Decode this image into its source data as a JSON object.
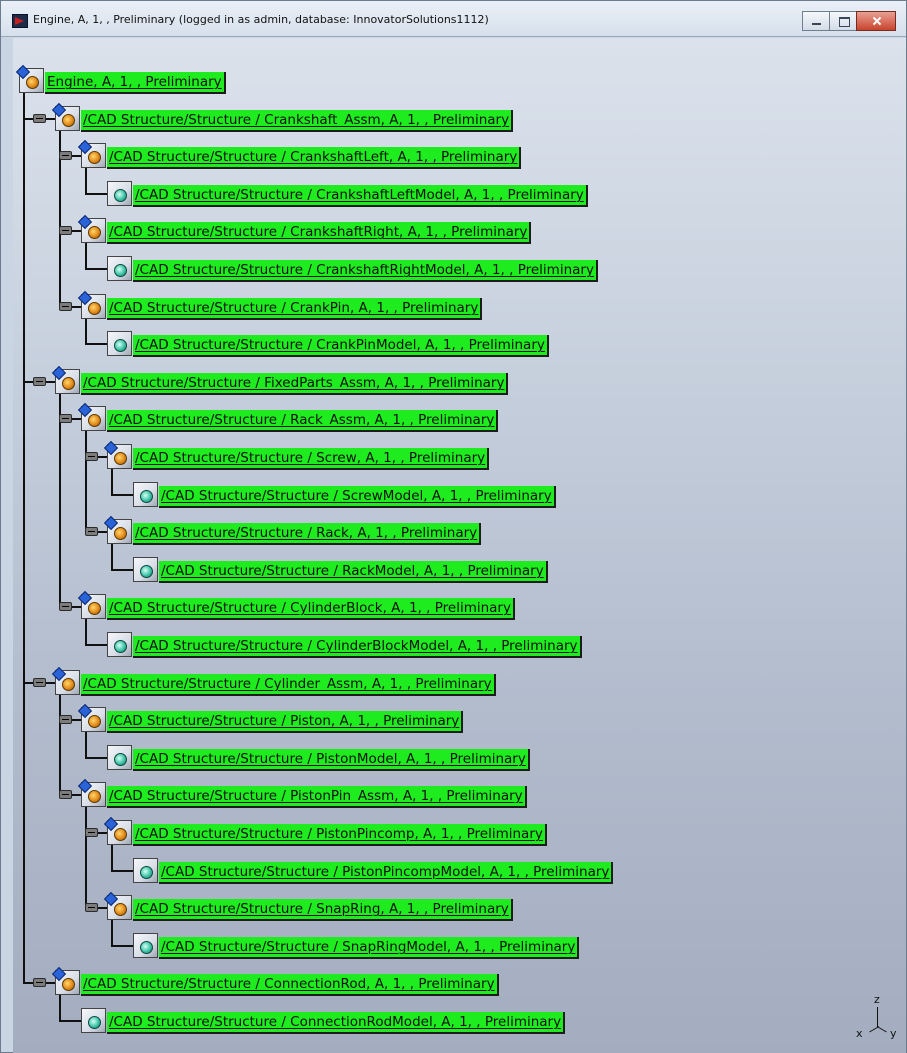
{
  "window": {
    "title": "Engine, A, 1, , Preliminary (logged in as admin, database: InnovatorSolutions1112)"
  },
  "tree": {
    "nodes": [
      {
        "label": "Engine, A, 1, , Preliminary",
        "icon": "assembly-icon",
        "expandable": false
      },
      {
        "label": "/CAD Structure/Structure / Crankshaft_Assm, A, 1, , Preliminary",
        "icon": "assembly-icon",
        "expandable": true
      },
      {
        "label": "/CAD Structure/Structure / CrankshaftLeft, A, 1, , Preliminary",
        "icon": "assembly-icon",
        "expandable": true
      },
      {
        "label": "/CAD Structure/Structure / CrankshaftLeftModel, A, 1, , Preliminary",
        "icon": "part-icon",
        "expandable": false
      },
      {
        "label": "/CAD Structure/Structure / CrankshaftRight, A, 1, , Preliminary",
        "icon": "assembly-icon",
        "expandable": true
      },
      {
        "label": "/CAD Structure/Structure / CrankshaftRightModel, A, 1, , Preliminary",
        "icon": "part-icon",
        "expandable": false
      },
      {
        "label": "/CAD Structure/Structure / CrankPin, A, 1, , Preliminary",
        "icon": "assembly-icon",
        "expandable": true
      },
      {
        "label": "/CAD Structure/Structure / CrankPinModel, A, 1, , Preliminary",
        "icon": "part-icon",
        "expandable": false
      },
      {
        "label": "/CAD Structure/Structure / FixedParts_Assm, A, 1, , Preliminary",
        "icon": "assembly-icon",
        "expandable": true
      },
      {
        "label": "/CAD Structure/Structure / Rack_Assm, A, 1, , Preliminary",
        "icon": "assembly-icon",
        "expandable": true
      },
      {
        "label": "/CAD Structure/Structure / Screw, A, 1, , Preliminary",
        "icon": "assembly-icon",
        "expandable": true
      },
      {
        "label": "/CAD Structure/Structure / ScrewModel, A, 1, , Preliminary",
        "icon": "part-icon",
        "expandable": false
      },
      {
        "label": "/CAD Structure/Structure / Rack, A, 1, , Preliminary",
        "icon": "assembly-icon",
        "expandable": true
      },
      {
        "label": "/CAD Structure/Structure / RackModel, A, 1, , Preliminary",
        "icon": "part-icon",
        "expandable": false
      },
      {
        "label": "/CAD Structure/Structure / CylinderBlock, A, 1, , Preliminary",
        "icon": "assembly-icon",
        "expandable": true
      },
      {
        "label": "/CAD Structure/Structure / CylinderBlockModel, A, 1, , Preliminary",
        "icon": "part-icon",
        "expandable": false
      },
      {
        "label": "/CAD Structure/Structure / Cylinder_Assm, A, 1, , Preliminary",
        "icon": "assembly-icon",
        "expandable": true
      },
      {
        "label": "/CAD Structure/Structure / Piston, A, 1, , Preliminary",
        "icon": "assembly-icon",
        "expandable": true
      },
      {
        "label": "/CAD Structure/Structure / PistonModel, A, 1, , Preliminary",
        "icon": "part-icon",
        "expandable": false
      },
      {
        "label": "/CAD Structure/Structure / PistonPin_Assm, A, 1, , Preliminary",
        "icon": "assembly-icon",
        "expandable": true
      },
      {
        "label": "/CAD Structure/Structure / PistonPincomp, A, 1, , Preliminary",
        "icon": "assembly-icon",
        "expandable": true
      },
      {
        "label": "/CAD Structure/Structure / PistonPincompModel, A, 1, , Preliminary",
        "icon": "part-icon",
        "expandable": false
      },
      {
        "label": "/CAD Structure/Structure / SnapRing, A, 1, , Preliminary",
        "icon": "assembly-icon",
        "expandable": true
      },
      {
        "label": "/CAD Structure/Structure / SnapRingModel, A, 1, , Preliminary",
        "icon": "part-icon",
        "expandable": false
      },
      {
        "label": "/CAD Structure/Structure / ConnectionRod, A, 1, , Preliminary",
        "icon": "assembly-icon",
        "expandable": true
      },
      {
        "label": "/CAD Structure/Structure / ConnectionRodModel, A, 1, , Preliminary",
        "icon": "part-icon",
        "expandable": false
      }
    ]
  },
  "axis_compass": {
    "x": "x",
    "y": "y",
    "z": "z"
  },
  "colors": {
    "label_bg": "#1fec1f",
    "background_top": "#dbe2ec",
    "background_bottom": "#a3adbf"
  }
}
